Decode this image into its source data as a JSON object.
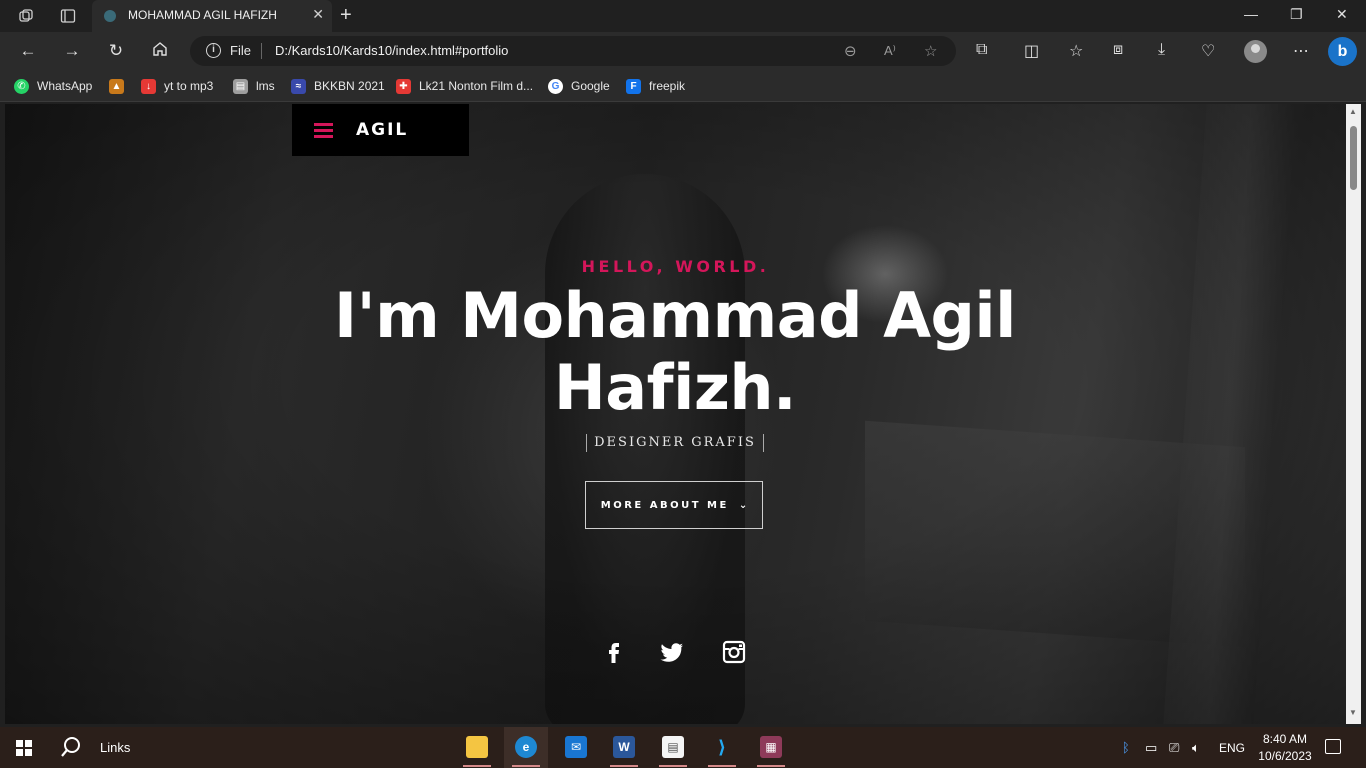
{
  "browser": {
    "tab_title": "MOHAMMAD AGIL HAFIZH",
    "address": {
      "scheme_label": "File",
      "url": "D:/Kards10/Kards10/index.html#portfolio"
    },
    "bookmarks": [
      {
        "label": "WhatsApp",
        "color": "#25d366",
        "icon": "whatsapp-icon"
      },
      {
        "label": "",
        "color": "#c8791b",
        "icon": "tower-icon"
      },
      {
        "label": "yt to mp3",
        "color": "#e53935",
        "icon": "download-icon"
      },
      {
        "label": "lms",
        "color": "#9e9e9e",
        "icon": "lms-icon"
      },
      {
        "label": "BKKBN 2021",
        "color": "#3949ab",
        "icon": "bkkbn-icon"
      },
      {
        "label": "Lk21 Nonton Film d...",
        "color": "#e53935",
        "icon": "lk21-icon"
      },
      {
        "label": "Google",
        "color": "#ffffff",
        "icon": "google-icon"
      },
      {
        "label": "freepik",
        "color": "#1273eb",
        "icon": "freepik-icon"
      }
    ]
  },
  "page": {
    "logo": "AGIL",
    "greeting": "HELLO, WORLD.",
    "headline": "I'm Mohammad Agil Hafizh.",
    "role": "DESIGNER GRAFIS",
    "cta": "MORE ABOUT ME",
    "accent_color": "#d4165a",
    "social": [
      "facebook-icon",
      "twitter-icon",
      "instagram-icon"
    ]
  },
  "taskbar": {
    "search_label": "Links",
    "language": "ENG",
    "time": "8:40 AM",
    "date": "10/6/2023"
  }
}
